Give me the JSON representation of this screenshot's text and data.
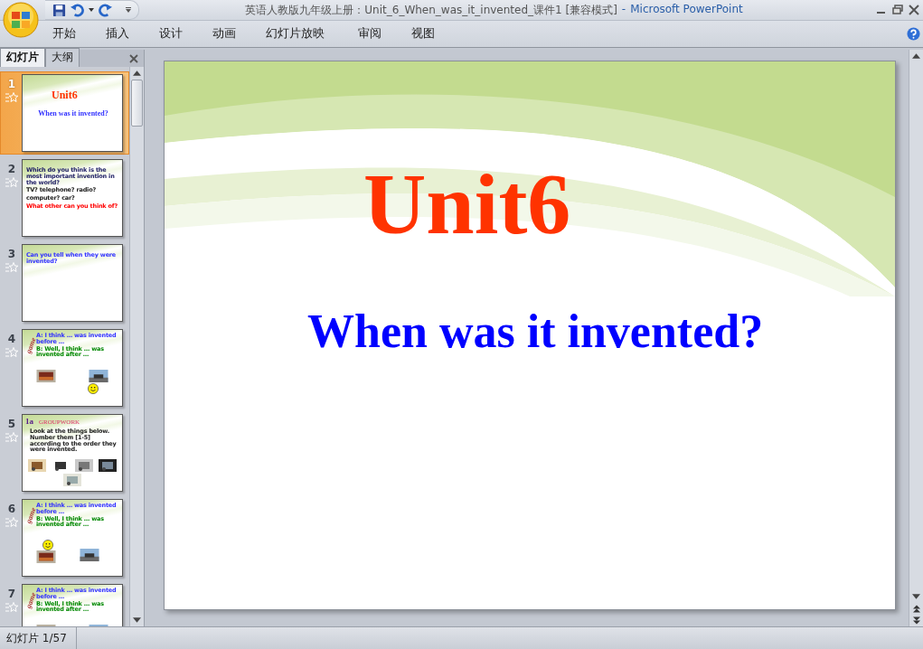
{
  "window": {
    "title": "英语人教版九年级上册：Unit_6_When_was_it_invented_课件1 [兼容模式]",
    "separator": "-",
    "app_name": "Microsoft PowerPoint"
  },
  "ribbon_tabs": [
    {
      "label": "开始"
    },
    {
      "label": "插入"
    },
    {
      "label": "设计"
    },
    {
      "label": "动画"
    },
    {
      "label": "幻灯片放映"
    },
    {
      "label": "审阅"
    },
    {
      "label": "视图"
    }
  ],
  "panel_tabs": [
    {
      "label": "幻灯片",
      "selected": true
    },
    {
      "label": "大纲",
      "selected": false
    }
  ],
  "slides": [
    {
      "number": "1",
      "selected": true,
      "kind": "title",
      "lines": [
        {
          "text": "Unit6",
          "color": "#ff3300"
        },
        {
          "text": "When was it invented?",
          "color": "#3333ff"
        }
      ]
    },
    {
      "number": "2",
      "selected": false,
      "kind": "text",
      "lines": [
        {
          "text": "Which do you think is the most important invention in the world?",
          "color": "#222266"
        },
        {
          "text": "TV?   telephone?   radio?",
          "color": "#222222"
        },
        {
          "text": "computer?   car?",
          "color": "#222222"
        },
        {
          "text": "What other can you think of?",
          "color": "#ff0000"
        }
      ]
    },
    {
      "number": "3",
      "selected": false,
      "kind": "text",
      "lines": [
        {
          "text": "Can you tell when they were invented?",
          "color": "#3333ff"
        }
      ]
    },
    {
      "number": "4",
      "selected": false,
      "kind": "dialog",
      "side_label": "game",
      "lines": [
        {
          "text": "A: I think … was invented before …",
          "color": "#3333ff"
        },
        {
          "text": "B: Well, I think … was invented after …",
          "color": "#008800"
        }
      ]
    },
    {
      "number": "5",
      "selected": false,
      "kind": "groupwork",
      "heading": "1a",
      "side_label": "GROUPWORK",
      "lines": [
        {
          "text": "Look at the things below. Number them [1-5] according to the order they were invented.",
          "color": "#222222"
        }
      ]
    },
    {
      "number": "6",
      "selected": false,
      "kind": "dialog2",
      "side_label": "game",
      "lines": [
        {
          "text": "A: I think … was invented before …",
          "color": "#3333ff"
        },
        {
          "text": "B: Well, I think … was invented after …",
          "color": "#008800"
        }
      ]
    },
    {
      "number": "7",
      "selected": false,
      "kind": "dialog",
      "side_label": "game",
      "lines": [
        {
          "text": "A: I think … was invented before …",
          "color": "#3333ff"
        },
        {
          "text": "B: Well, I think … was invented after …",
          "color": "#008800"
        }
      ]
    }
  ],
  "slide": {
    "title": "Unit6",
    "subtitle": "When was it invented?"
  },
  "status_bar": {
    "slide_info": "幻灯片 1/57"
  }
}
